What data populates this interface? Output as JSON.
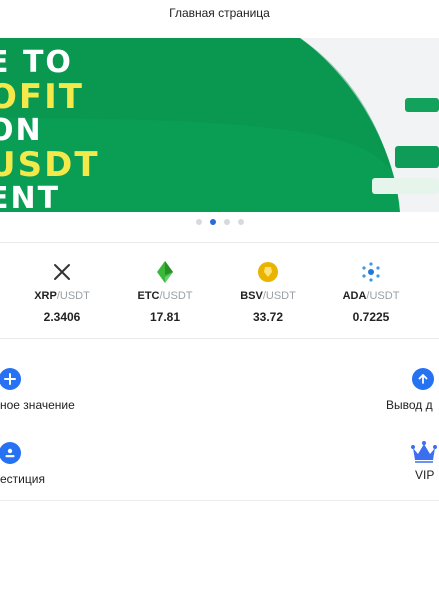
{
  "header": {
    "title": "Главная страница"
  },
  "banner": {
    "line1": "E TO",
    "line2": "OFIT",
    "line3": "ON",
    "line4": "USDT",
    "line5": "ENT",
    "colors": {
      "green": "#0a9d54",
      "yellow": "#f3e94a"
    }
  },
  "carousel": {
    "count": 4,
    "active_index": 1
  },
  "tickers": [
    {
      "base": "XRP",
      "quote": "/USDT",
      "price": "2.3406",
      "icon": "xrp-icon"
    },
    {
      "base": "ETC",
      "quote": "/USDT",
      "price": "17.81",
      "icon": "etc-icon"
    },
    {
      "base": "BSV",
      "quote": "/USDT",
      "price": "33.72",
      "icon": "bsv-icon"
    },
    {
      "base": "ADA",
      "quote": "/USDT",
      "price": "0.7225",
      "icon": "ada-icon"
    }
  ],
  "actions": {
    "deposit": {
      "label": "ное значение",
      "icon": "plus-icon"
    },
    "withdraw": {
      "label": "Вывод д",
      "icon": "arrow-up-icon"
    },
    "invest": {
      "label": "естиция",
      "icon": "invest-icon"
    },
    "vip": {
      "label": "VIP",
      "icon": "crown-icon"
    }
  },
  "accent_color": "#2672f2"
}
